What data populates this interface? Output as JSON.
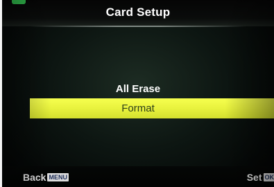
{
  "screen": {
    "title": "Card Setup"
  },
  "menu": {
    "items": [
      {
        "label": "All Erase",
        "selected": false
      },
      {
        "label": "Format",
        "selected": true
      }
    ]
  },
  "footer": {
    "back_label": "Back",
    "back_key": "MENU",
    "set_label": "Set",
    "set_key": "OK"
  },
  "colors": {
    "highlight": "#ecf442",
    "background": "#0d1612",
    "indicator": "#2fb54a"
  }
}
